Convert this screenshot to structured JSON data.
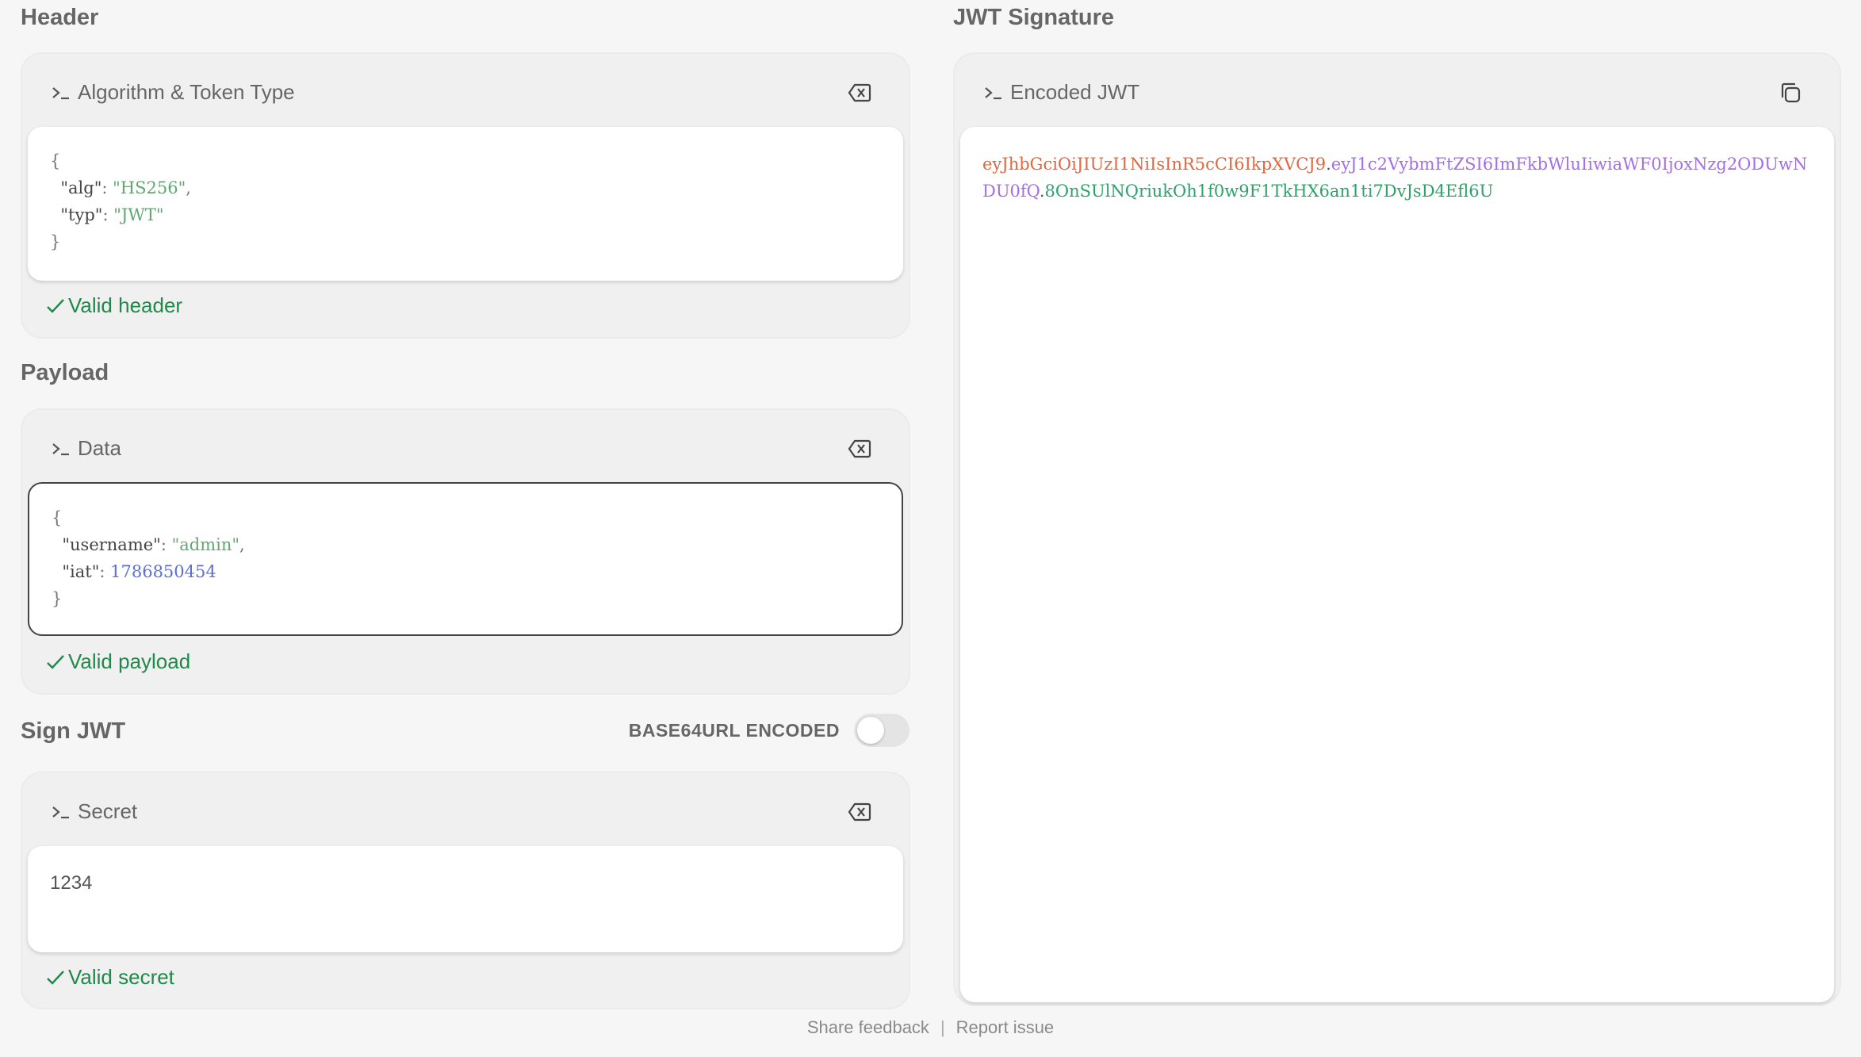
{
  "left": {
    "header": {
      "title": "Header",
      "card_label": "Algorithm & Token Type",
      "lines": {
        "open": "{",
        "alg_key": "\"alg\"",
        "alg_val": "\"HS256\"",
        "typ_key": "\"typ\"",
        "typ_val": "\"JWT\"",
        "close": "}"
      },
      "status": "Valid header"
    },
    "payload": {
      "title": "Payload",
      "card_label": "Data",
      "lines": {
        "open": "{",
        "username_key": "\"username\"",
        "username_val": "\"admin\"",
        "iat_key": "\"iat\"",
        "iat_val": "1786850454",
        "close": "}"
      },
      "status": "Valid payload"
    },
    "sign": {
      "title": "Sign JWT",
      "toggle_label": "BASE64URL ENCODED",
      "toggle_on": false,
      "card_label": "Secret",
      "secret_value": "1234",
      "status": "Valid secret"
    }
  },
  "right": {
    "title": "JWT Signature",
    "card_label": "Encoded JWT",
    "jwt": {
      "header_part": "eyJhbGciOiJIUzI1NiIsInR5cCI6IkpXVCJ9",
      "payload_part": "eyJ1c2VybmFtZSI6ImFkbWluIiwiaWF0IjoxNzg2ODUwNDU0fQ",
      "signature_part": "8OnSUlNQriukOh1f0w9F1TkHX6an1ti7DvJsD4Efl6U",
      "dot": "."
    }
  },
  "footer": {
    "feedback": "Share feedback",
    "separator": "|",
    "report": "Report issue"
  },
  "colors": {
    "jwt_header": "#e0683f",
    "jwt_payload": "#a46ee6",
    "jwt_signature": "#2aa46a",
    "valid": "#1e8a4a"
  },
  "icons": {
    "prompt": "terminal-prompt-icon",
    "clear": "backspace-clear-icon",
    "copy": "copy-icon",
    "check": "check-icon"
  }
}
